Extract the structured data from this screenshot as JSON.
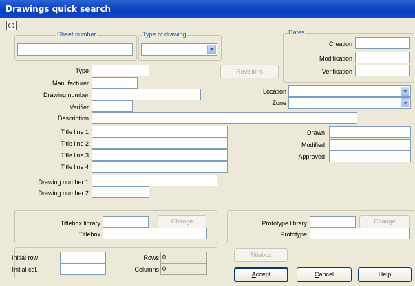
{
  "window": {
    "title": "Drawings quick search"
  },
  "sheet_group": {
    "label": "Sheet number",
    "value": ""
  },
  "type_group": {
    "label": "Type of drawing",
    "value": ""
  },
  "dates": {
    "label": "Dates",
    "creation_label": "Creation",
    "modification_label": "Modification",
    "verification_label": "Verification"
  },
  "fields": {
    "type": "Type",
    "manufacturer": "Manufacturer",
    "drawing_number": "Drawing number",
    "verifier": "Verifier",
    "description": "Description",
    "location": "Location",
    "zone": "Zone",
    "title_line_1": "Title line 1",
    "title_line_2": "Title line 2",
    "title_line_3": "Title line 3",
    "title_line_4": "Title line 4",
    "drawn": "Drawn",
    "modified": "Modified",
    "approved": "Approved",
    "drawing_number_1": "Drawing number 1",
    "drawing_number_2": "Drawing number 2"
  },
  "titlebox_group": {
    "library_label": "Titlebox library",
    "titlebox_label": "Titlebox",
    "change_label": "Change"
  },
  "prototype_group": {
    "library_label": "Prototype library",
    "prototype_label": "Prototype",
    "change_label": "Change"
  },
  "rows_group": {
    "initial_row_label": "Initial row",
    "initial_col_label": "Initial col.",
    "rows_label": "Rows",
    "rows_value": "0",
    "columns_label": "Columns",
    "columns_value": "0"
  },
  "buttons": {
    "revisions": "Revisions",
    "titlebox": "Titlebox",
    "accept_u": "A",
    "accept_rest": "ccept",
    "cancel_u": "C",
    "cancel_rest": "ancel",
    "help": "Help"
  }
}
